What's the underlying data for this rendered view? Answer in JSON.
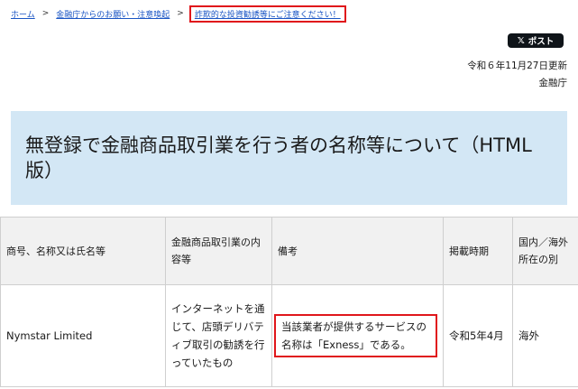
{
  "breadcrumb": {
    "home": "ホーム",
    "sep1": ">",
    "parent": "金融庁からのお願い・注意喚起",
    "sep2": ">",
    "current": "詐欺的な投資勧誘等にご注意ください！"
  },
  "share": {
    "x_icon": "𝕏",
    "label": "ポスト"
  },
  "meta": {
    "updated": "令和６年11月27日更新",
    "agency": "金融庁"
  },
  "page_title": "無登録で金融商品取引業を行う者の名称等について（HTML版）",
  "table": {
    "headers": [
      "商号、名称又は氏名等",
      "金融商品取引業の内容等",
      "備考",
      "掲載時期",
      "国内／海外所在の別"
    ],
    "rows": [
      {
        "name": "Nymstar Limited",
        "business": "インターネットを通じて、店頭デリバティブ取引の勧誘を行っていたもの",
        "remarks": "当該業者が提供するサービスの名称は「Exness」である。",
        "date": "令和5年4月",
        "location": "海外"
      }
    ]
  },
  "colors": {
    "link": "#1a55c4",
    "highlight_border": "#e0161b",
    "title_bg": "#d3e7f5"
  }
}
